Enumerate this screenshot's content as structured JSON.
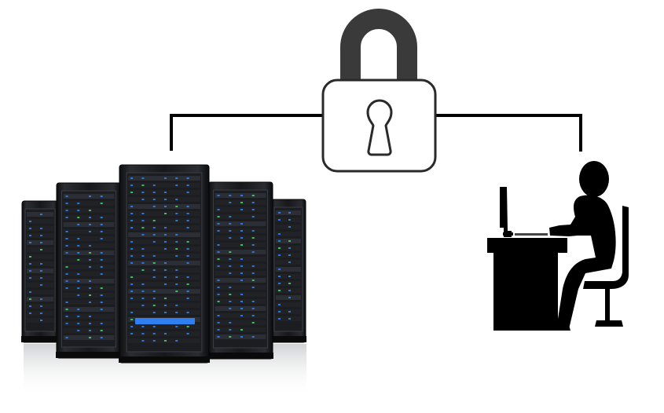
{
  "diagram": {
    "nodes": [
      {
        "id": "server-rack",
        "icon": "server-rack-icon"
      },
      {
        "id": "lock",
        "icon": "padlock-icon"
      },
      {
        "id": "user",
        "icon": "user-at-desk-icon"
      }
    ],
    "edges": [
      {
        "from": "server-rack",
        "to": "lock"
      },
      {
        "from": "lock",
        "to": "user"
      }
    ],
    "colors": {
      "line": "#000000",
      "shackle": "#3a3a3a",
      "lock_outline": "#2a2a2a",
      "lock_body": "#ffffff",
      "server_body": "#1b1d21",
      "server_led_blue": "#2f7ff0",
      "server_led_green": "#3fd06a",
      "silhouette": "#000000"
    }
  }
}
